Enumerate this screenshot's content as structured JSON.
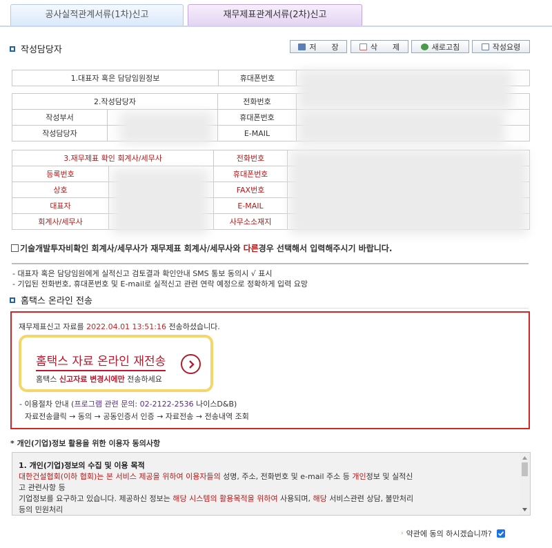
{
  "tabs": [
    {
      "label": "공사실적관계서류(1차)신고"
    },
    {
      "label": "재무제표관계서류(2차)신고"
    }
  ],
  "writer_section": {
    "title": "작성담당자"
  },
  "toolbar": {
    "save_label": "저　　장",
    "delete_label": "삭　　제",
    "refresh_label": "새로고침",
    "guide_label": "작성요령"
  },
  "table1": {
    "rep_label": "1.대표자 혹은 담당임원정보",
    "mobile_label": "휴대폰번호"
  },
  "table2": {
    "header": "2.작성담당자",
    "phone_label": "전화번호",
    "dept_label": "작성부서",
    "mobile_label": "휴대폰번호",
    "writer_label": "작성담당자",
    "email_label": "E-MAIL"
  },
  "table3": {
    "header": "3.재무제표 확인 회계사/세무사",
    "phone_label": "전화번호",
    "reg_label": "등록번호",
    "mobile_label": "휴대폰번호",
    "name_label": "상호",
    "fax_label": "FAX번호",
    "ceo_label": "대표자",
    "email_label": "E-MAIL",
    "acct_label": "회계사/세무사",
    "office_label": "사무소소재지"
  },
  "diff_check": {
    "before": "기술개발투자비확인 회계사/세무사가 재무제표 회계사/세무사와 ",
    "highlight": "다른",
    "after": "경우 선택해서 입력해주시기 바랍니다."
  },
  "notes": [
    "- 대표자 혹은 담당임원에게 실적신고 검토결과 확인안내 SMS 통보 동의시 √ 표시",
    "- 기입된 전화번호, 휴대폰번호 및 E-mail로 실적신고 관련 연락 예정으로 정확하게 입력 요망"
  ],
  "hometax_section": {
    "title": "홈택스 온라인 전송"
  },
  "hometax": {
    "sent_prefix": "재무제표신고 자료를 ",
    "sent_datetime": "2022.04.01 13:51:16",
    "sent_suffix": " 전송하셨습니다.",
    "resend_title": "홈택스 자료 온라인 재전송",
    "resend_sub_prefix": "홈택스 ",
    "resend_sub_highlight": "신고자료 변경시에만",
    "resend_sub_suffix": " 전송하세요",
    "guide_prefix": "- 이용절차 안내 (",
    "guide_contact": "프로그램 관련 문의: 02-2122-2536",
    "guide_company": " 나이스D&B)",
    "steps": "자료전송클릭 → 동의 → 공동인증서 인증 → 자료전송 → 전송내역 조회"
  },
  "consent": {
    "title": "* 개인(기업)정보 활용을 위한 이용자 동의사항",
    "heading": "1. 개인(기업)정보의 수집 및 이용 목적",
    "p1_a": "대한건설협회(이하 협회)",
    "p1_b": "는 본 서비스 제공을 위하여 이용자들의",
    "p1_c": " 성명, 주소, 전화번호 및 e-mail 주소 등 ",
    "p1_d": "개인",
    "p1_e": "정보 및 실적신",
    "p1_f": "고 관련사항 등",
    "p2_a": "기업정보를 요구하고 있습니다. 제공하신 정보는 ",
    "p2_b": "해당 시스템의 활용목적을 위하여",
    "p2_c": " 사용되며, ",
    "p2_d": "해당",
    "p2_e": " 서비스관련 상담, 불만처리",
    "p3": "등의 민원처리",
    "agree_label": "약관에 동의 하시겠습니까?"
  },
  "colors": {
    "accent_blue": "#1f5fb0",
    "alert_red": "#d42525",
    "highlight_yellow": "#f4d66a",
    "label_red": "#b31818"
  }
}
